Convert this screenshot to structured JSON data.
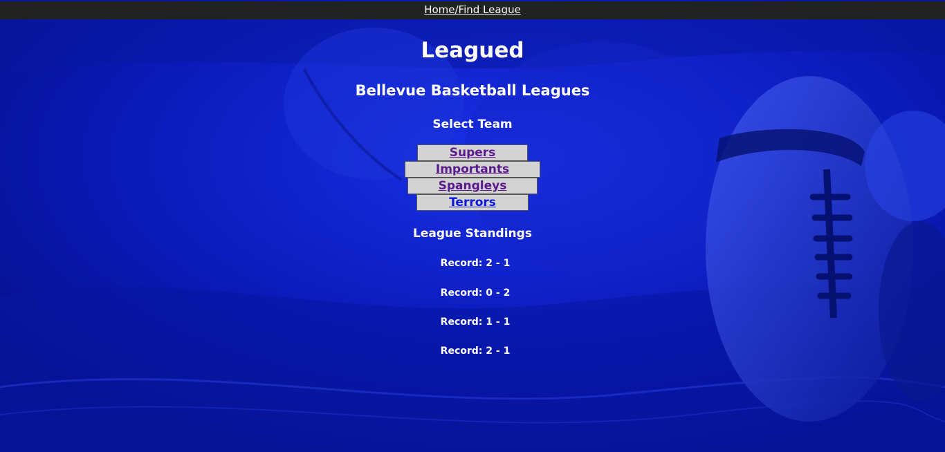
{
  "nav": {
    "home_link": "Home/Find League"
  },
  "header": {
    "title": "Leagued",
    "subtitle": "Bellevue Basketball Leagues"
  },
  "teams": {
    "heading": "Select Team",
    "items": [
      {
        "label": "Supers"
      },
      {
        "label": "Importants"
      },
      {
        "label": "Spangleys"
      },
      {
        "label": "Terrors"
      }
    ]
  },
  "standings": {
    "heading": "League Standings",
    "records": [
      {
        "text": "Record: 2 - 1"
      },
      {
        "text": "Record: 0 - 2"
      },
      {
        "text": "Record: 1 - 1"
      },
      {
        "text": "Record: 2 - 1"
      }
    ]
  },
  "colors": {
    "background": "#0a1ab0",
    "topbar": "#222222",
    "button_bg": "#d3d3d3",
    "visited_link": "#5a1a8c",
    "link": "#0c16d6"
  }
}
